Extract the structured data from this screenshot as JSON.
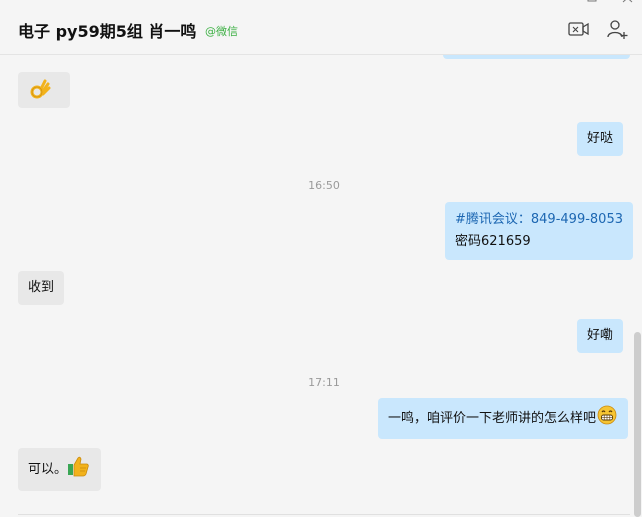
{
  "header": {
    "title": "电子 py59期5组 肖一鸣",
    "source": "@微信"
  },
  "window_controls": {
    "minimize_icon": "minimize-icon",
    "maximize_icon": "maximize-icon",
    "close_icon": "close-icon"
  },
  "toolbar": {
    "video_call_icon": "video-call-icon",
    "add_member_icon": "add-member-icon"
  },
  "messages": [
    {
      "side": "in",
      "emoji": "ok-hand"
    },
    {
      "side": "out",
      "text": "好哒"
    },
    {
      "type": "time",
      "text": "16:50"
    },
    {
      "side": "out",
      "link": "#腾讯会议：849-499-8053",
      "text": "密码621659"
    },
    {
      "side": "in",
      "text": "收到"
    },
    {
      "side": "out",
      "text": "好嘞"
    },
    {
      "type": "time",
      "text": "17:11"
    },
    {
      "side": "out",
      "text": "一鸣，咱评价一下老师讲的怎么样吧",
      "emoji": "grin"
    },
    {
      "side": "in",
      "text": "可以。",
      "emoji": "thumbs-up"
    }
  ],
  "colors": {
    "background": "#f5f5f5",
    "incoming_bubble": "#e8e8e8",
    "outgoing_bubble": "#c9e7fd",
    "link": "#1d67b2",
    "source_green": "#3cb043"
  }
}
